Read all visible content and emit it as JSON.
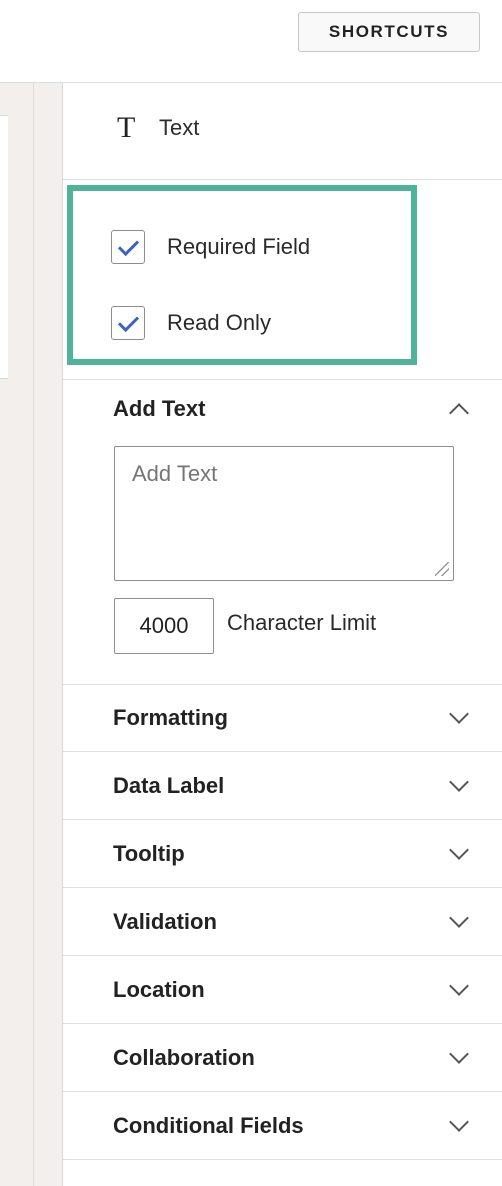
{
  "toolbar": {
    "shortcuts_label": "SHORTCUTS"
  },
  "field_type": {
    "icon": "text-type-icon",
    "icon_glyph": "T",
    "label": "Text"
  },
  "options": {
    "required": {
      "label": "Required Field",
      "checked": true
    },
    "read_only": {
      "label": "Read Only",
      "checked": true
    },
    "highlight_color": "#4fb39a"
  },
  "add_text": {
    "title": "Add Text",
    "placeholder": "Add Text",
    "value": "",
    "char_limit": "4000",
    "char_limit_label": "Character Limit"
  },
  "sections": [
    {
      "title": "Formatting"
    },
    {
      "title": "Data Label"
    },
    {
      "title": "Tooltip"
    },
    {
      "title": "Validation"
    },
    {
      "title": "Location"
    },
    {
      "title": "Collaboration"
    },
    {
      "title": "Conditional Fields"
    }
  ]
}
